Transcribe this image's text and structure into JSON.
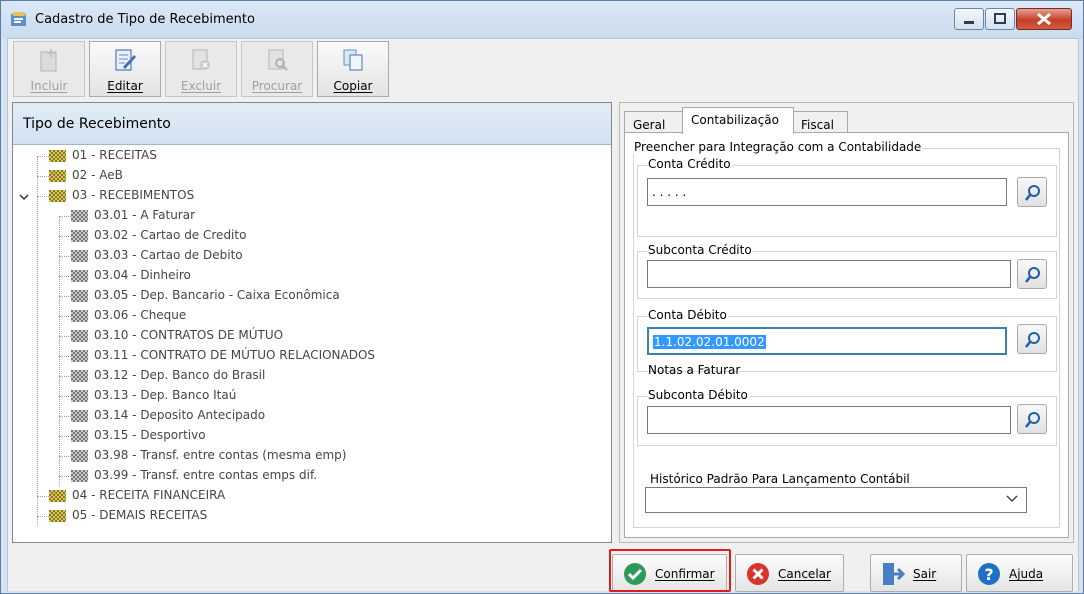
{
  "window": {
    "title": "Cadastro de Tipo de Recebimento"
  },
  "toolbar": {
    "incluir": "Incluir",
    "editar": "Editar",
    "excluir": "Excluir",
    "procurar": "Procurar",
    "copiar": "Copiar"
  },
  "tree": {
    "header": "Tipo de Recebimento",
    "nodes": [
      "01 - RECEITAS",
      "02 - AeB",
      "03 - RECEBIMENTOS",
      "03.01 - A Faturar",
      "03.02 - Cartao de Credito",
      "03.03 - Cartao de Debito",
      "03.04 - Dinheiro",
      "03.05 - Dep. Bancario - Caixa Econômica",
      "03.06 - Cheque",
      "03.10 - CONTRATOS DE MÚTUO",
      "03.11 - CONTRATO DE MÚTUO RELACIONADOS",
      "03.12 - Dep. Banco do Brasil",
      "03.13 - Dep. Banco Itaú",
      "03.14 - Deposito Antecipado",
      "03.15 - Desportivo",
      "03.98 - Transf. entre  contas (mesma emp)",
      "03.99 - Transf. entre  contas emps dif.",
      "04 - RECEITA FINANCEIRA",
      "05 - DEMAIS RECEITAS"
    ]
  },
  "tabs": [
    "Geral",
    "Contabilização",
    "Fiscal"
  ],
  "contab": {
    "section_label": "Preencher para Integração com a Contabilidade",
    "conta_credito_label": "Conta Crédito",
    "conta_credito_value": ". . . . .",
    "subconta_credito_label": "Subconta Crédito",
    "subconta_credito_value": "",
    "conta_debito_label": "Conta Débito",
    "conta_debito_value": "1.1.02.02.01.0002",
    "conta_debito_desc": "Notas a Faturar",
    "subconta_debito_label": "Subconta Débito",
    "subconta_debito_value": "",
    "historico_label": "Histórico Padrão Para Lançamento Contábil",
    "historico_value": ""
  },
  "buttons": {
    "confirmar": "Confirmar",
    "cancelar": "Cancelar",
    "sair": "Sair",
    "ajuda": "Ajuda"
  },
  "colors": {
    "accent": "#3399ff",
    "confirm": "#2e9a5a",
    "cancel": "#d9342b",
    "help": "#1f6fc5",
    "highlight": "#e11a1a"
  }
}
